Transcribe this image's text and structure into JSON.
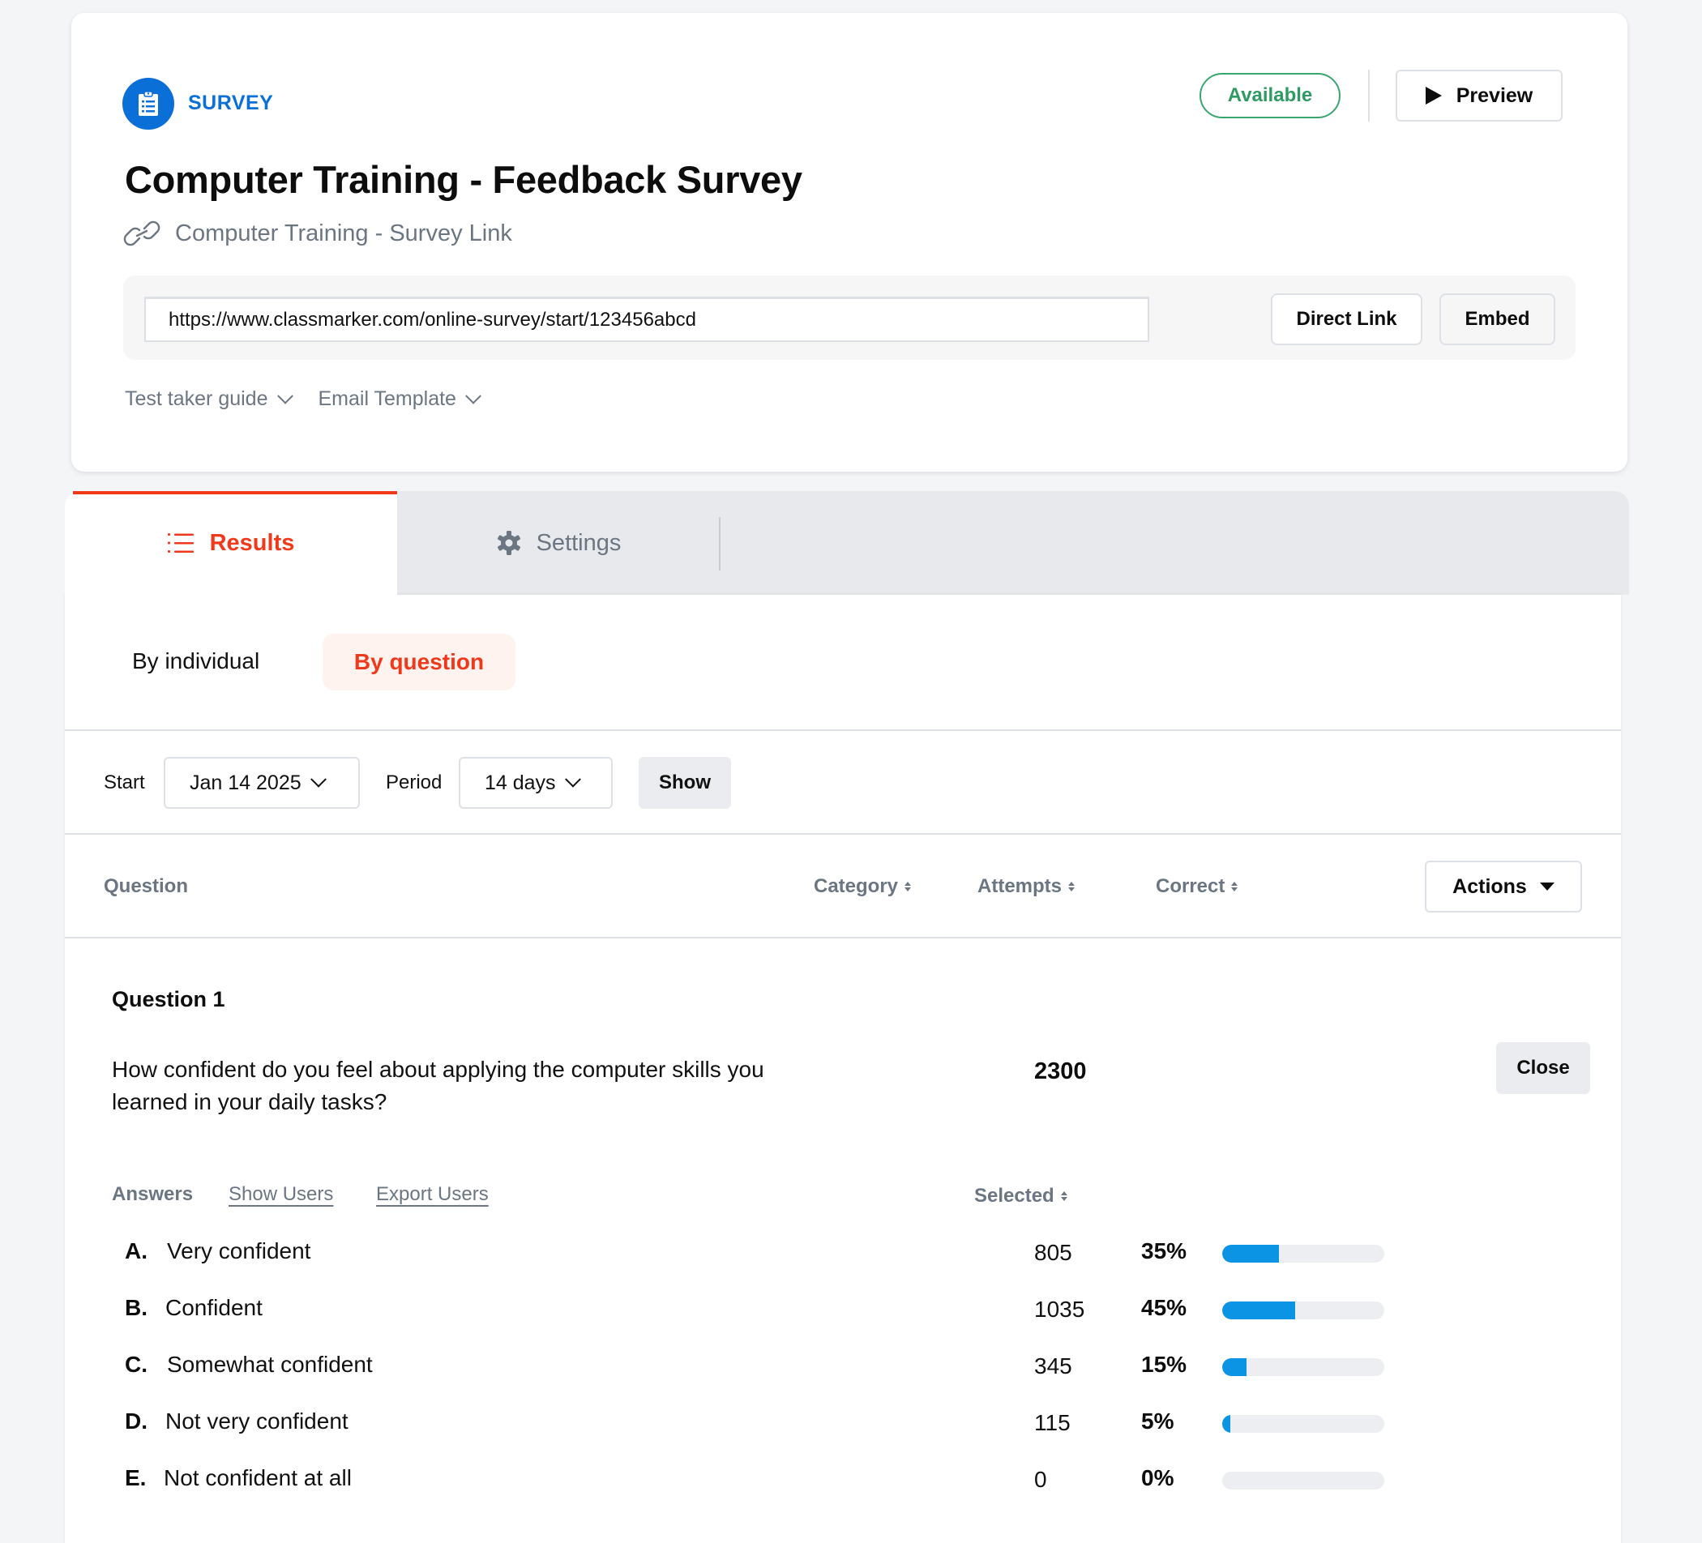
{
  "colors": {
    "brand_blue": "#0b6fd8",
    "accent_red": "#f0391b",
    "status_green": "#3aa66f",
    "bar_fill": "#0b94e4",
    "bar_track": "#eceef1"
  },
  "header": {
    "type_label": "SURVEY",
    "type_icon": "clipboard-list-icon",
    "title": "Computer Training - Feedback Survey",
    "link_icon": "link-icon",
    "link_name": "Computer Training - Survey Link",
    "status": "Available",
    "preview_label": "Preview",
    "url": "https://www.classmarker.com/online-survey/start/123456abcd",
    "direct_link_label": "Direct Link",
    "embed_label": "Embed",
    "guide_label": "Test taker guide",
    "email_template_label": "Email Template"
  },
  "tabs": [
    {
      "label": "Results",
      "icon": "list-icon",
      "active": true
    },
    {
      "label": "Settings",
      "icon": "gear-icon",
      "active": false
    }
  ],
  "subtabs": [
    {
      "label": "By individual",
      "active": false
    },
    {
      "label": "By question",
      "active": true
    }
  ],
  "filters": {
    "start_label": "Start",
    "start_value": "Jan 14 2025",
    "period_label": "Period",
    "period_value": "14 days",
    "show_label": "Show"
  },
  "table_header": {
    "question": "Question",
    "category": "Category",
    "attempts": "Attempts",
    "correct": "Correct",
    "actions": "Actions"
  },
  "question": {
    "title": "Question 1",
    "text": "How confident do you feel about applying the computer skills you learned in your daily tasks?",
    "total": "2300",
    "close_label": "Close",
    "answers_label": "Answers",
    "show_users_label": "Show Users",
    "export_users_label": "Export Users",
    "selected_label": "Selected",
    "answers": [
      {
        "letter": "A.",
        "text": "Very confident",
        "count": "805",
        "pct_label": "35%",
        "pct": 35
      },
      {
        "letter": "B.",
        "text": "Confident",
        "count": "1035",
        "pct_label": "45%",
        "pct": 45
      },
      {
        "letter": "C.",
        "text": "Somewhat confident",
        "count": "345",
        "pct_label": "15%",
        "pct": 15
      },
      {
        "letter": "D.",
        "text": "Not very confident",
        "count": "115",
        "pct_label": "5%",
        "pct": 5
      },
      {
        "letter": "E.",
        "text": "Not confident at all",
        "count": "0",
        "pct_label": "0%",
        "pct": 0
      }
    ]
  }
}
